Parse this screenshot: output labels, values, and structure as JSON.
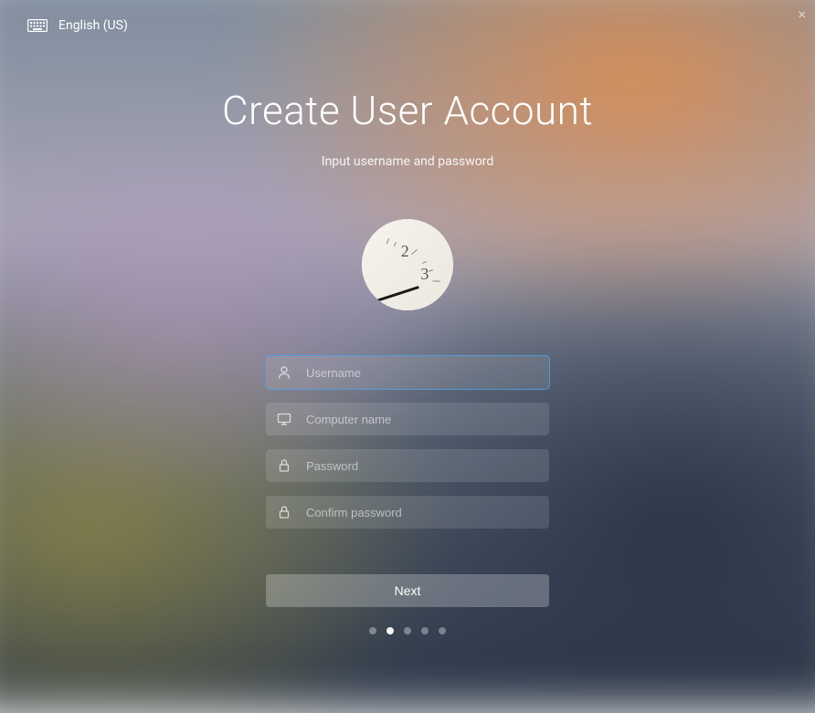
{
  "topbar": {
    "language": "English (US)"
  },
  "page": {
    "title": "Create User Account",
    "subtitle": "Input username and password"
  },
  "form": {
    "username": {
      "placeholder": "Username",
      "value": ""
    },
    "computer_name": {
      "placeholder": "Computer name",
      "value": ""
    },
    "password": {
      "placeholder": "Password",
      "value": ""
    },
    "confirm_password": {
      "placeholder": "Confirm password",
      "value": ""
    }
  },
  "buttons": {
    "next": "Next"
  },
  "progress": {
    "total_steps": 5,
    "current_step": 2
  },
  "avatar_icon": "clock-face-icon",
  "colors": {
    "focus_border": "#5ba3e0",
    "text": "#ffffff"
  }
}
